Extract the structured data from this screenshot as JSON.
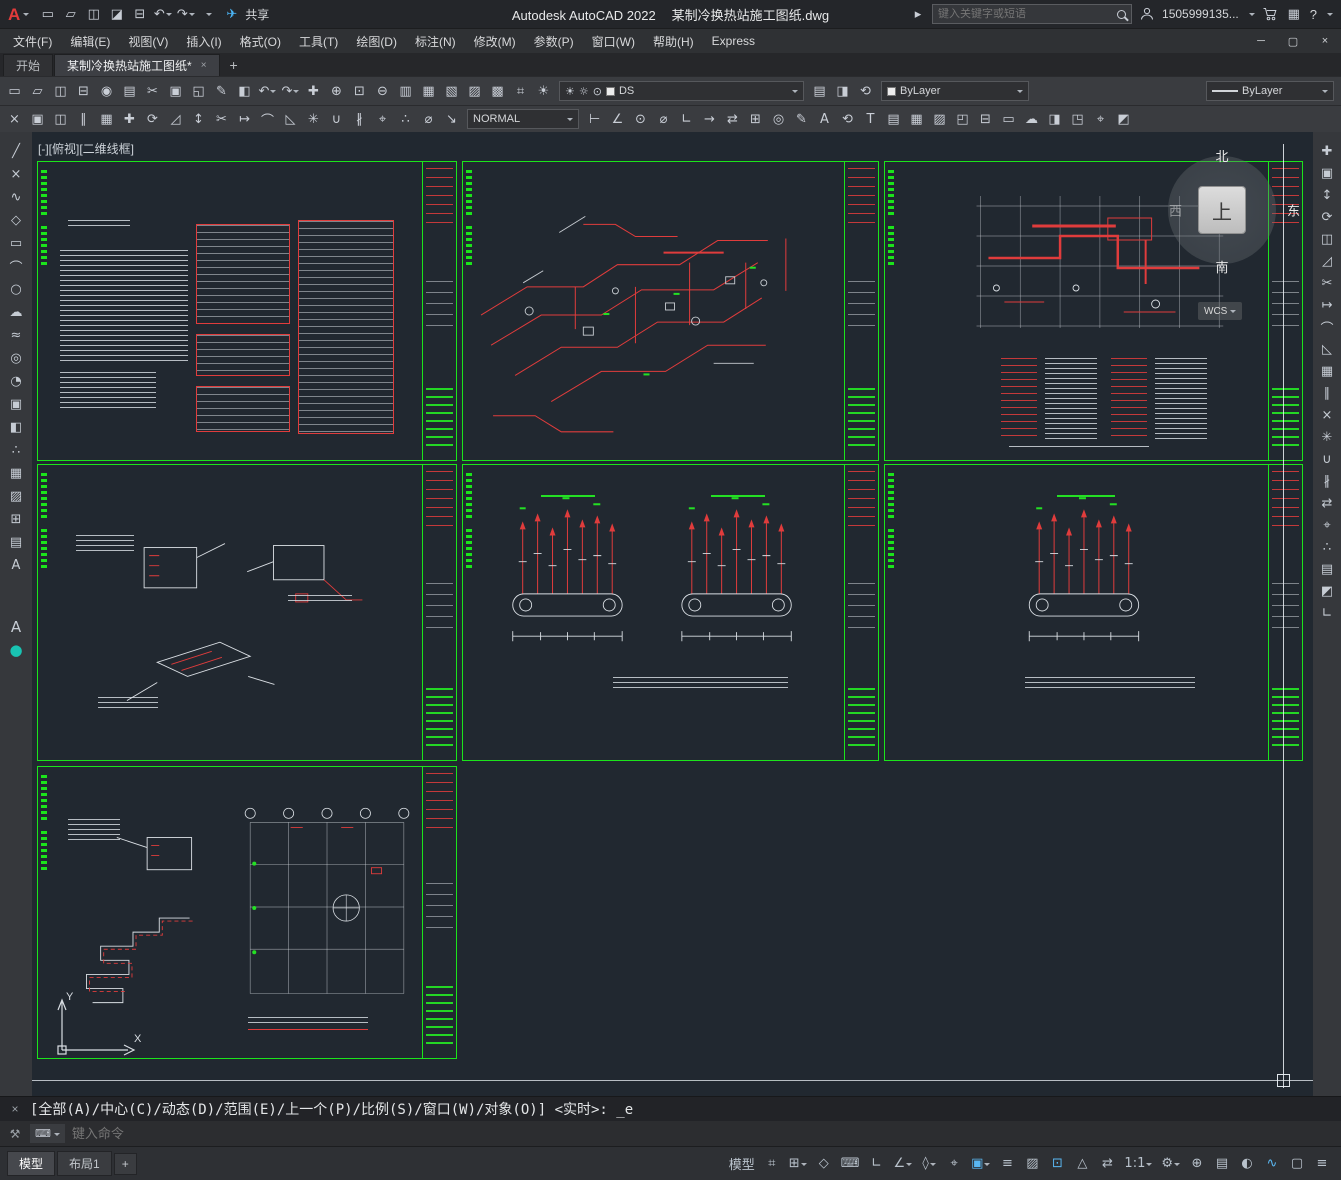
{
  "titlebar": {
    "logo": "A",
    "app_title": "Autodesk AutoCAD 2022",
    "doc_title": "某制冷换热站施工图纸.dwg",
    "share_label": "共享",
    "collapse_glyph": "▸",
    "search_placeholder": "键入关键字或短语",
    "account": "1505999135...",
    "apps_glyph": "▦",
    "help": "?",
    "qat": [
      {
        "name": "new-drawing-icon",
        "glyph": "▭"
      },
      {
        "name": "open-drawing-icon",
        "glyph": "▱"
      },
      {
        "name": "save-drawing-icon",
        "glyph": "◫"
      },
      {
        "name": "save-as-icon",
        "glyph": "◪"
      },
      {
        "name": "plot-icon",
        "glyph": "⊟"
      },
      {
        "name": "undo-icon",
        "glyph": "↶",
        "caret": true
      },
      {
        "name": "redo-icon",
        "glyph": "↷",
        "caret": true
      },
      {
        "name": "qat-menu-icon",
        "glyph": " ",
        "caret": true
      },
      {
        "name": "share-icon",
        "glyph": "✈",
        "color": "#4ab3f4"
      }
    ]
  },
  "window_controls": [
    {
      "name": "minimize-button",
      "glyph": "─"
    },
    {
      "name": "maximize-button",
      "glyph": "▢"
    },
    {
      "name": "close-button",
      "glyph": "×"
    }
  ],
  "menus": [
    {
      "name": "menu-file",
      "label": "文件(F)"
    },
    {
      "name": "menu-edit",
      "label": "编辑(E)"
    },
    {
      "name": "menu-view",
      "label": "视图(V)"
    },
    {
      "name": "menu-insert",
      "label": "插入(I)"
    },
    {
      "name": "menu-format",
      "label": "格式(O)"
    },
    {
      "name": "menu-tools",
      "label": "工具(T)"
    },
    {
      "name": "menu-draw",
      "label": "绘图(D)"
    },
    {
      "name": "menu-dimension",
      "label": "标注(N)"
    },
    {
      "name": "menu-modify",
      "label": "修改(M)"
    },
    {
      "name": "menu-parametric",
      "label": "参数(P)"
    },
    {
      "name": "menu-window",
      "label": "窗口(W)"
    },
    {
      "name": "menu-help",
      "label": "帮助(H)"
    },
    {
      "name": "menu-express",
      "label": "Express"
    }
  ],
  "filetabs": {
    "start": "开始",
    "doc": "某制冷换热站施工图纸*",
    "close": "×",
    "add": "+"
  },
  "toolbar1": {
    "icons": [
      {
        "name": "new-drawing-icon",
        "glyph": "▭"
      },
      {
        "name": "open-drawing-icon",
        "glyph": "▱"
      },
      {
        "name": "save-drawing-icon",
        "glyph": "◫"
      },
      {
        "name": "plot-icon",
        "glyph": "⊟"
      },
      {
        "name": "plot-preview-icon",
        "glyph": "◉"
      },
      {
        "name": "publish-icon",
        "glyph": "▤"
      },
      {
        "name": "cut-clip-icon",
        "glyph": "✂"
      },
      {
        "name": "copy-clip-icon",
        "glyph": "▣"
      },
      {
        "name": "paste-clip-icon",
        "glyph": "◱"
      },
      {
        "name": "match-properties-icon",
        "glyph": "✎"
      },
      {
        "name": "block-editor-icon",
        "glyph": "◧"
      },
      {
        "name": "undo-icon",
        "glyph": "↶",
        "caret": true
      },
      {
        "name": "redo-icon",
        "glyph": "↷",
        "caret": true
      },
      {
        "name": "pan-icon",
        "glyph": "✚"
      },
      {
        "name": "zoom-realtime-icon",
        "glyph": "⊕"
      },
      {
        "name": "zoom-window-icon",
        "glyph": "⊡"
      },
      {
        "name": "zoom-previous-icon",
        "glyph": "⊖"
      },
      {
        "name": "properties-palette-icon",
        "glyph": "▥"
      },
      {
        "name": "design-center-icon",
        "glyph": "▦"
      },
      {
        "name": "tool-palettes-icon",
        "glyph": "▧"
      },
      {
        "name": "sheet-set-manager-icon",
        "glyph": "▨"
      },
      {
        "name": "markup-set-manager-icon",
        "glyph": "▩"
      },
      {
        "name": "field-icon",
        "glyph": "⌗"
      },
      {
        "name": "render-icon",
        "glyph": "☀"
      }
    ],
    "layer_field": {
      "icons": [
        "☀",
        "☼",
        "⊙"
      ],
      "label": "DS"
    },
    "mid_icons": [
      {
        "name": "layer-properties-icon",
        "glyph": "▤"
      },
      {
        "name": "layer-states-icon",
        "glyph": "◨"
      },
      {
        "name": "layer-previous-icon",
        "glyph": "⟲"
      }
    ],
    "color_field": {
      "label": "ByLayer"
    },
    "linetype_field": {
      "label": "ByLayer"
    }
  },
  "toolbar2": {
    "icons_left": [
      {
        "name": "erase-icon",
        "glyph": "×"
      },
      {
        "name": "copy-icon",
        "glyph": "▣"
      },
      {
        "name": "mirror-icon",
        "glyph": "◫"
      },
      {
        "name": "offset-icon",
        "glyph": "∥"
      },
      {
        "name": "array-icon",
        "glyph": "▦"
      },
      {
        "name": "move-icon",
        "glyph": "✚"
      },
      {
        "name": "rotate-icon",
        "glyph": "⟳"
      },
      {
        "name": "scale-icon",
        "glyph": "◿"
      },
      {
        "name": "stretch-icon",
        "glyph": "↕"
      },
      {
        "name": "trim-icon",
        "glyph": "✂"
      },
      {
        "name": "extend-icon",
        "glyph": "↦"
      },
      {
        "name": "fillet-icon",
        "glyph": "⌒"
      },
      {
        "name": "chamfer-icon",
        "glyph": "◺"
      },
      {
        "name": "explode-icon",
        "glyph": "✳"
      },
      {
        "name": "join-icon",
        "glyph": "∪"
      },
      {
        "name": "break-icon",
        "glyph": "∦"
      },
      {
        "name": "measure-icon",
        "glyph": "⌖"
      },
      {
        "name": "divide-icon",
        "glyph": "∴"
      },
      {
        "name": "diameter-icon",
        "glyph": "⌀"
      },
      {
        "name": "leader-icon",
        "glyph": "↘"
      }
    ],
    "style_field": {
      "label": "NORMAL"
    },
    "icons_right": [
      {
        "name": "dim-linear-icon",
        "glyph": "⊢"
      },
      {
        "name": "dim-aligned-icon",
        "glyph": "∠"
      },
      {
        "name": "dim-radius-icon",
        "glyph": "⊙"
      },
      {
        "name": "dim-diameter-icon",
        "glyph": "⌀"
      },
      {
        "name": "dim-angular-icon",
        "glyph": "∟"
      },
      {
        "name": "dim-continue-icon",
        "glyph": "→"
      },
      {
        "name": "dim-baseline-icon",
        "glyph": "⇄"
      },
      {
        "name": "tolerance-icon",
        "glyph": "⊞"
      },
      {
        "name": "center-mark-icon",
        "glyph": "◎"
      },
      {
        "name": "dim-edit-icon",
        "glyph": "✎"
      },
      {
        "name": "dim-text-edit-icon",
        "glyph": "A"
      },
      {
        "name": "dim-update-icon",
        "glyph": "⟲"
      },
      {
        "name": "text-icon",
        "glyph": "T"
      },
      {
        "name": "table-icon",
        "glyph": "▤"
      },
      {
        "name": "hatch-icon",
        "glyph": "▦"
      },
      {
        "name": "gradient-icon",
        "glyph": "▨"
      },
      {
        "name": "boundary-icon",
        "glyph": "◰"
      },
      {
        "name": "region-icon",
        "glyph": "⊟"
      },
      {
        "name": "wipeout-icon",
        "glyph": "▭"
      },
      {
        "name": "revcloud-icon",
        "glyph": "☁"
      },
      {
        "name": "insert-icon",
        "glyph": "◨"
      },
      {
        "name": "xref-icon",
        "glyph": "◳"
      },
      {
        "name": "osnap-settings-icon",
        "glyph": "⌖"
      },
      {
        "name": "group-icon",
        "glyph": "◩"
      }
    ]
  },
  "left_palette": {
    "tools": [
      {
        "name": "line-tool",
        "glyph": "╱"
      },
      {
        "name": "construction-line-tool",
        "glyph": "×"
      },
      {
        "name": "polyline-tool",
        "glyph": "∿"
      },
      {
        "name": "polygon-tool",
        "glyph": "◇"
      },
      {
        "name": "rectangle-tool",
        "glyph": "▭"
      },
      {
        "name": "arc-tool",
        "glyph": "⌒"
      },
      {
        "name": "circle-tool",
        "glyph": "○"
      },
      {
        "name": "revision-cloud-tool",
        "glyph": "☁"
      },
      {
        "name": "spline-tool",
        "glyph": "≈"
      },
      {
        "name": "ellipse-tool",
        "glyph": "◎"
      },
      {
        "name": "ellipse-arc-tool",
        "glyph": "◔"
      },
      {
        "name": "insert-block-tool",
        "glyph": "▣"
      },
      {
        "name": "create-block-tool",
        "glyph": "◧"
      },
      {
        "name": "point-tool",
        "glyph": "∴"
      },
      {
        "name": "hatch-tool",
        "glyph": "▦"
      },
      {
        "name": "gradient-tool",
        "glyph": "▨"
      },
      {
        "name": "region-tool",
        "glyph": "⊞"
      },
      {
        "name": "table-tool",
        "glyph": "▤"
      },
      {
        "name": "mtext-tool",
        "glyph": "A"
      }
    ],
    "extras": [
      {
        "name": "text-style-icon",
        "glyph": "A"
      },
      {
        "name": "point-display-icon",
        "glyph": "●",
        "color": "#19c3b2"
      }
    ]
  },
  "right_palette": [
    {
      "name": "move-icon",
      "glyph": "✚"
    },
    {
      "name": "copy-icon",
      "glyph": "▣"
    },
    {
      "name": "stretch-icon",
      "glyph": "↕"
    },
    {
      "name": "rotate-icon",
      "glyph": "⟳"
    },
    {
      "name": "mirror-icon",
      "glyph": "◫"
    },
    {
      "name": "scale-icon",
      "glyph": "◿"
    },
    {
      "name": "trim-icon",
      "glyph": "✂"
    },
    {
      "name": "extend-icon",
      "glyph": "↦"
    },
    {
      "name": "fillet-icon",
      "glyph": "⌒"
    },
    {
      "name": "chamfer-icon",
      "glyph": "◺"
    },
    {
      "name": "array-icon",
      "glyph": "▦"
    },
    {
      "name": "offset-icon",
      "glyph": "∥"
    },
    {
      "name": "erase-icon",
      "glyph": "×"
    },
    {
      "name": "explode-icon",
      "glyph": "✳"
    },
    {
      "name": "join-icon",
      "glyph": "∪"
    },
    {
      "name": "break-icon",
      "glyph": "∦"
    },
    {
      "name": "align-icon",
      "glyph": "⇄"
    },
    {
      "name": "measure-icon",
      "glyph": "⌖"
    },
    {
      "name": "divide-icon",
      "glyph": "∴"
    },
    {
      "name": "layer-properties-icon",
      "glyph": "▤"
    },
    {
      "name": "group-icon",
      "glyph": "◩"
    },
    {
      "name": "ucs-tool-icon",
      "glyph": "∟"
    }
  ],
  "canvas": {
    "viewport_label": "[-][俯视][二维线框]",
    "viewcube": {
      "n": "北",
      "e": "东",
      "s": "南",
      "w": "西",
      "top": "上"
    },
    "wcs": "WCS",
    "ucs": {
      "x": "X",
      "y": "Y"
    }
  },
  "command": {
    "close": "×",
    "customize": "⚒",
    "chip": "⌨",
    "prompt": "[全部(A)/中心(C)/动态(D)/范围(E)/上一个(P)/比例(S)/窗口(W)/对象(O)] <实时>: _e",
    "input_placeholder": "键入命令"
  },
  "statusbar": {
    "model_tab": "模型",
    "layout_tab": "布局1",
    "add_layout": "+",
    "items": [
      {
        "name": "model-space-button",
        "label": "模型"
      },
      {
        "name": "grid-display-toggle",
        "glyph": "⌗"
      },
      {
        "name": "snap-mode-toggle",
        "glyph": "⊞",
        "caret": true
      },
      {
        "name": "infer-constraints-toggle",
        "glyph": "◇"
      },
      {
        "name": "dynamic-input-toggle",
        "glyph": "⌨"
      },
      {
        "name": "ortho-mode-toggle",
        "glyph": "∟"
      },
      {
        "name": "polar-tracking-toggle",
        "glyph": "∠",
        "caret": true
      },
      {
        "name": "isometric-drafting-toggle",
        "glyph": "◊",
        "caret": true
      },
      {
        "name": "object-snap-tracking-toggle",
        "glyph": "⌖"
      },
      {
        "name": "object-snap-toggle",
        "glyph": "▣",
        "active": true,
        "caret": true
      },
      {
        "name": "lineweight-display-toggle",
        "glyph": "≡"
      },
      {
        "name": "transparency-toggle",
        "glyph": "▨"
      },
      {
        "name": "selection-cycling-toggle",
        "glyph": "⊡",
        "active": true
      },
      {
        "name": "annotation-visibility-toggle",
        "glyph": "△"
      },
      {
        "name": "autoscale-toggle",
        "glyph": "⇄"
      },
      {
        "name": "annotation-scale-button",
        "label": "1:1",
        "caret": true
      },
      {
        "name": "workspace-switcher-button",
        "glyph": "⚙",
        "caret": true
      },
      {
        "name": "annotation-monitor-button",
        "glyph": "⊕"
      },
      {
        "name": "quick-properties-toggle",
        "glyph": "▤"
      },
      {
        "name": "isolate-objects-button",
        "glyph": "◐"
      },
      {
        "name": "graphics-performance-button",
        "glyph": "∿",
        "active": true
      },
      {
        "name": "clean-screen-button",
        "glyph": "▢"
      },
      {
        "name": "customization-menu-button",
        "glyph": "≡"
      }
    ]
  }
}
